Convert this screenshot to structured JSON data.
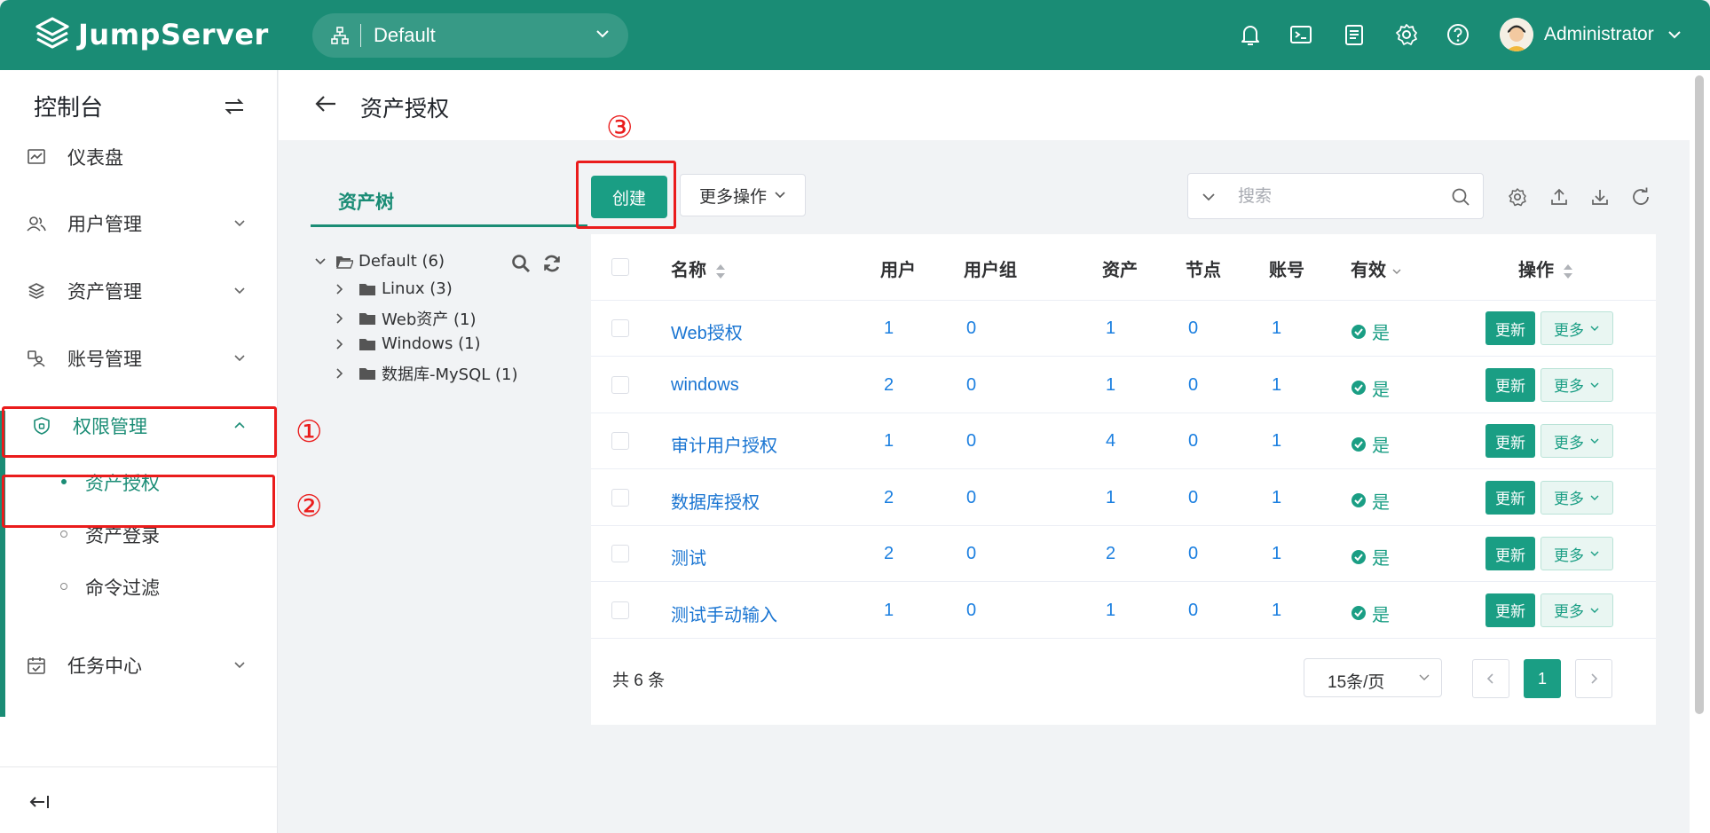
{
  "header": {
    "logo_text": "JumpServer",
    "org": "Default",
    "user": "Administrator",
    "icons": [
      "bell-icon",
      "terminal-icon",
      "tickets-icon",
      "settings-icon",
      "help-icon"
    ]
  },
  "sidebar": {
    "title": "控制台",
    "items": [
      {
        "label": "仪表盘",
        "icon": "dashboard-icon"
      },
      {
        "label": "用户管理",
        "icon": "users-icon"
      },
      {
        "label": "资产管理",
        "icon": "assets-icon"
      },
      {
        "label": "账号管理",
        "icon": "accounts-icon"
      },
      {
        "label": "权限管理",
        "icon": "shield-icon"
      },
      {
        "label": "任务中心",
        "icon": "calendar-icon"
      }
    ],
    "sub_items": [
      {
        "label": "资产授权",
        "active": true
      },
      {
        "label": "资产登录",
        "active": false
      },
      {
        "label": "命令过滤",
        "active": false
      }
    ]
  },
  "annotations": [
    "①",
    "②",
    "③"
  ],
  "page": {
    "title": "资产授权"
  },
  "tree": {
    "tab_label": "资产树",
    "root": "Default (6)",
    "children": [
      "Linux (3)",
      "Web资产 (1)",
      "Windows (1)",
      "数据库-MySQL (1)"
    ]
  },
  "toolbar": {
    "create_label": "创建",
    "more_label": "更多操作",
    "search_placeholder": "搜索"
  },
  "table": {
    "headers": {
      "name": "名称",
      "users": "用户",
      "user_groups": "用户组",
      "assets": "资产",
      "nodes": "节点",
      "accounts": "账号",
      "valid": "有效",
      "actions": "操作"
    },
    "rows": [
      {
        "name": "Web授权",
        "users": "1",
        "user_groups": "0",
        "assets": "1",
        "nodes": "0",
        "accounts": "1",
        "valid": "是"
      },
      {
        "name": "windows",
        "users": "2",
        "user_groups": "0",
        "assets": "1",
        "nodes": "0",
        "accounts": "1",
        "valid": "是"
      },
      {
        "name": "审计用户授权",
        "users": "1",
        "user_groups": "0",
        "assets": "4",
        "nodes": "0",
        "accounts": "1",
        "valid": "是"
      },
      {
        "name": "数据库授权",
        "users": "2",
        "user_groups": "0",
        "assets": "1",
        "nodes": "0",
        "accounts": "1",
        "valid": "是"
      },
      {
        "name": "测试",
        "users": "2",
        "user_groups": "0",
        "assets": "2",
        "nodes": "0",
        "accounts": "1",
        "valid": "是"
      },
      {
        "name": "测试手动输入",
        "users": "1",
        "user_groups": "0",
        "assets": "1",
        "nodes": "0",
        "accounts": "1",
        "valid": "是"
      }
    ],
    "update_label": "更新",
    "row_more_label": "更多"
  },
  "pagination": {
    "total": "共 6 条",
    "page_size": "15条/页",
    "current_page": "1"
  },
  "colors": {
    "primary": "#1a8c75",
    "button": "#1a9e84",
    "link": "#1a75d2",
    "annotation": "#ea1c1c"
  }
}
